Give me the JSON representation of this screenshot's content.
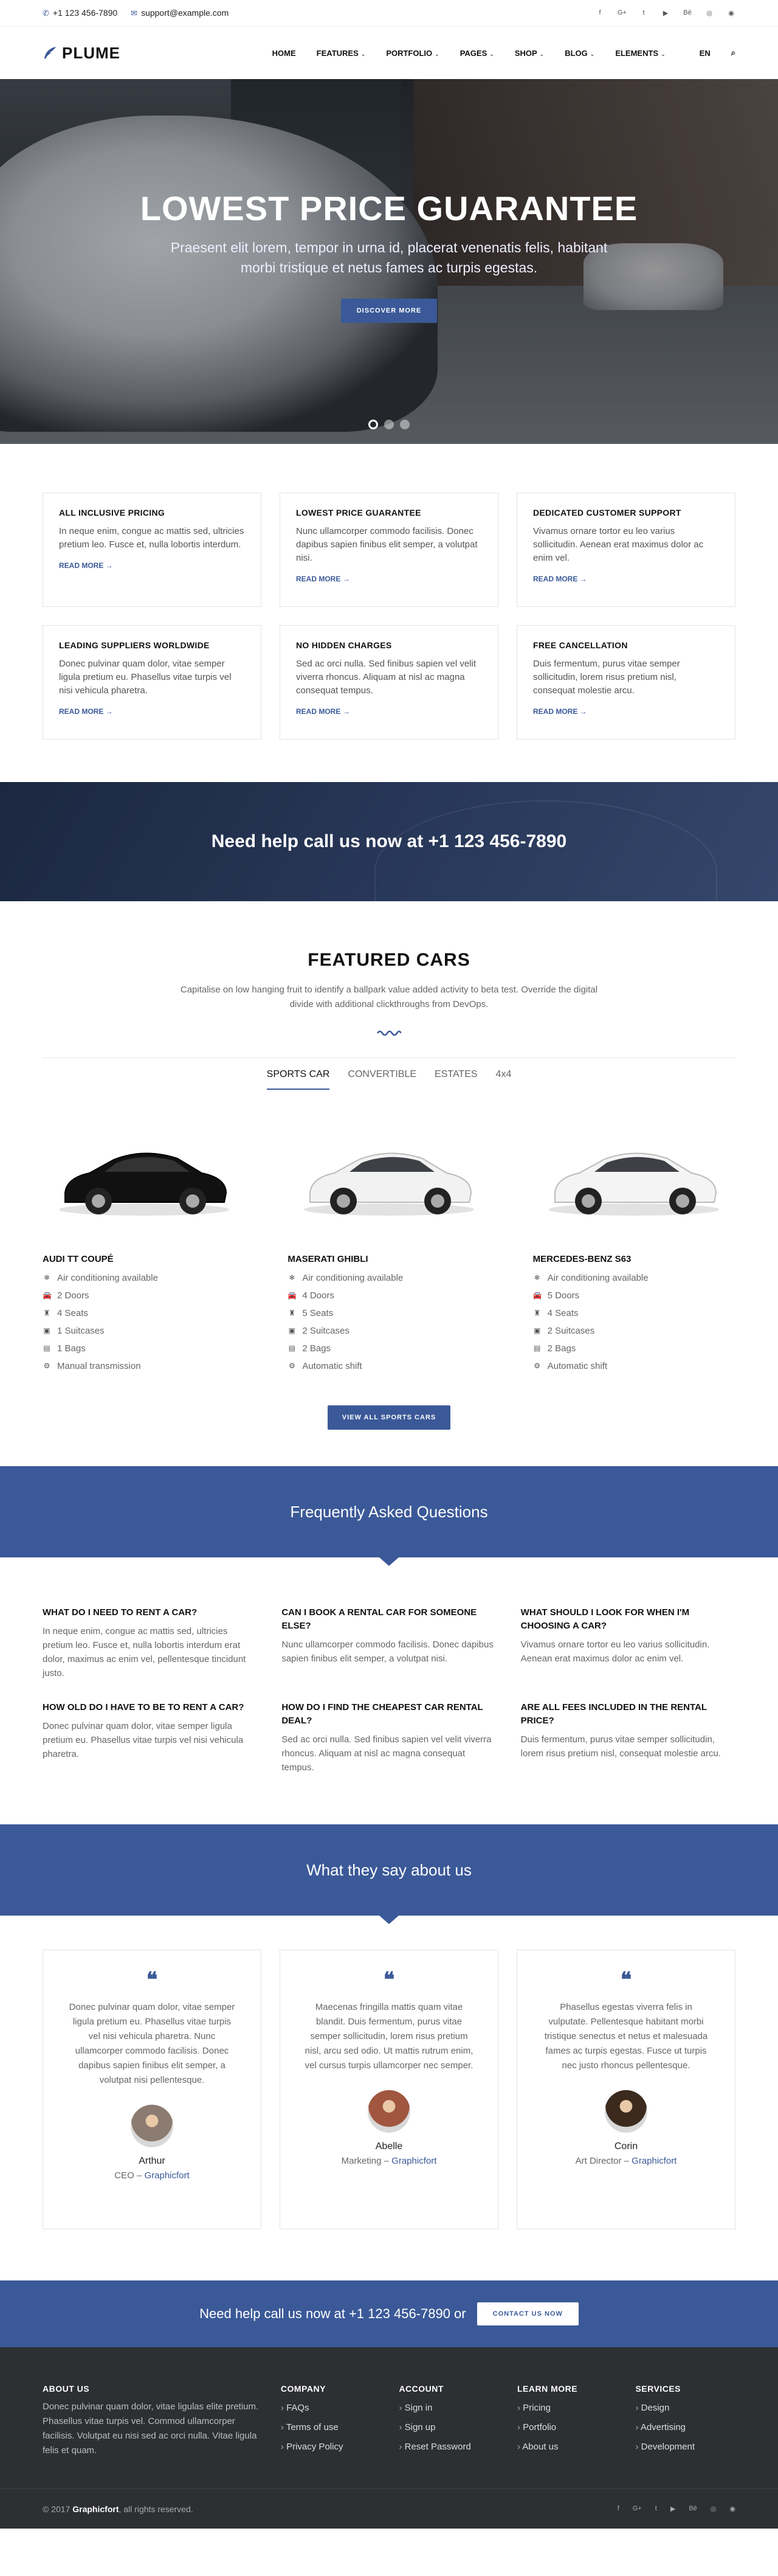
{
  "topbar": {
    "phone": "+1 123 456-7890",
    "email": "support@example.com",
    "social": [
      "f",
      "G+",
      "t",
      "▶",
      "Bē",
      "◎",
      "◉"
    ]
  },
  "header": {
    "logo": "PLUME",
    "nav": [
      {
        "label": "HOME",
        "caret": false
      },
      {
        "label": "FEATURES",
        "caret": true
      },
      {
        "label": "PORTFOLIO",
        "caret": true
      },
      {
        "label": "PAGES",
        "caret": true
      },
      {
        "label": "SHOP",
        "caret": true
      },
      {
        "label": "BLOG",
        "caret": true
      },
      {
        "label": "ELEMENTS",
        "caret": true
      }
    ],
    "lang": "EN"
  },
  "hero": {
    "title": "LOWEST PRICE GUARANTEE",
    "text": "Praesent elit lorem, tempor in urna id, placerat venenatis felis, habitant morbi tristique et netus fames ac turpis egestas.",
    "button": "DISCOVER MORE"
  },
  "features": [
    {
      "title": "ALL INCLUSIVE PRICING",
      "text": "In neque enim, congue ac mattis sed, ultricies pretium leo. Fusce et, nulla lobortis interdum.",
      "more": "READ MORE →"
    },
    {
      "title": "LOWEST PRICE GUARANTEE",
      "text": "Nunc ullamcorper commodo facilisis. Donec dapibus sapien finibus elit semper, a volutpat nisi.",
      "more": "READ MORE →"
    },
    {
      "title": "DEDICATED CUSTOMER SUPPORT",
      "text": "Vivamus ornare tortor eu leo varius sollicitudin. Aenean erat maximus dolor ac enim vel.",
      "more": "READ MORE →"
    },
    {
      "title": "LEADING SUPPLIERS WORLDWIDE",
      "text": "Donec pulvinar quam dolor, vitae semper ligula pretium eu. Phasellus vitae turpis vel nisi vehicula pharetra.",
      "more": "READ MORE →"
    },
    {
      "title": "NO HIDDEN CHARGES",
      "text": "Sed ac orci nulla. Sed finibus sapien vel velit viverra rhoncus. Aliquam at nisl ac magna consequat tempus.",
      "more": "READ MORE →"
    },
    {
      "title": "FREE CANCELLATION",
      "text": "Duis fermentum, purus vitae semper sollicitudin, lorem risus pretium nisl, consequat molestie arcu.",
      "more": "READ MORE →"
    }
  ],
  "help_band": "Need help call us now at +1 123 456-7890",
  "featured": {
    "title": "FEATURED CARS",
    "subtitle": "Capitalise on low hanging fruit to identify a ballpark value added activity to beta test. Override the digital divide with additional clickthroughs from DevOps.",
    "tabs": [
      "SPORTS CAR",
      "CONVERTIBLE",
      "ESTATES",
      "4x4"
    ],
    "cars": [
      {
        "name": "AUDI TT COUPÉ",
        "color": "#111111",
        "specs": [
          "Air conditioning available",
          "2 Doors",
          "4 Seats",
          "1 Suitcases",
          "1 Bags",
          "Manual transmission"
        ]
      },
      {
        "name": "MASERATI GHIBLI",
        "color": "#f2f2f2",
        "specs": [
          "Air conditioning available",
          "4 Doors",
          "5 Seats",
          "2 Suitcases",
          "2 Bags",
          "Automatic shift"
        ]
      },
      {
        "name": "MERCEDES-BENZ S63",
        "color": "#f4f4f4",
        "specs": [
          "Air conditioning available",
          "5 Doors",
          "4 Seats",
          "2 Suitcases",
          "2 Bags",
          "Automatic shift"
        ]
      }
    ],
    "spec_icons": [
      "❄",
      "🚘",
      "♜",
      "▣",
      "▤",
      "⚙"
    ],
    "button": "VIEW ALL SPORTS CARS"
  },
  "faq": {
    "title": "Frequently Asked Questions",
    "items": [
      {
        "q": "WHAT DO I NEED TO RENT A CAR?",
        "a": "In neque enim, congue ac mattis sed, ultricies pretium leo. Fusce et, nulla lobortis interdum erat dolor, maximus ac enim vel, pellentesque tincidunt justo."
      },
      {
        "q": "CAN I BOOK A RENTAL CAR FOR SOMEONE ELSE?",
        "a": "Nunc ullamcorper commodo facilisis. Donec dapibus sapien finibus elit semper, a volutpat nisi."
      },
      {
        "q": "WHAT SHOULD I LOOK FOR WHEN I'M CHOOSING A CAR?",
        "a": "Vivamus ornare tortor eu leo varius sollicitudin. Aenean erat maximus dolor ac enim vel."
      },
      {
        "q": "HOW OLD DO I HAVE TO BE TO RENT A CAR?",
        "a": "Donec pulvinar quam dolor, vitae semper ligula pretium eu. Phasellus vitae turpis vel nisi vehicula pharetra."
      },
      {
        "q": "HOW DO I FIND THE CHEAPEST CAR RENTAL DEAL?",
        "a": "Sed ac orci nulla. Sed finibus sapien vel velit viverra rhoncus. Aliquam at nisl ac magna consequat tempus."
      },
      {
        "q": "ARE ALL FEES INCLUDED IN THE RENTAL PRICE?",
        "a": "Duis fermentum, purus vitae semper sollicitudin, lorem risus pretium nisl, consequat molestie arcu."
      }
    ]
  },
  "testimonials": {
    "title": "What they say about us",
    "items": [
      {
        "text": "Donec pulvinar quam dolor, vitae semper ligula pretium eu. Phasellus vitae turpis vel nisi vehicula pharetra. Nunc ullamcorper commodo facilisis. Donec dapibus sapien finibus elit semper, a volutpat nisi pellentesque.",
        "name": "Arthur",
        "role": "CEO – ",
        "company": "Graphicfort",
        "avatar_color": "#8c7b70"
      },
      {
        "text": "Maecenas fringilla mattis quam vitae blandit. Duis fermentum, purus vitae semper sollicitudin, lorem risus pretium nisl, arcu sed odio. Ut mattis rutrum enim, vel cursus turpis ullamcorper nec semper.",
        "name": "Abelle",
        "role": "Marketing – ",
        "company": "Graphicfort",
        "avatar_color": "#a0563f"
      },
      {
        "text": "Phasellus egestas viverra felis in vulputate. Pellentesque habitant morbi tristique senectus et netus et malesuada fames ac turpis egestas. Fusce ut turpis nec justo rhoncus pellentesque.",
        "name": "Corin",
        "role": "Art Director – ",
        "company": "Graphicfort",
        "avatar_color": "#3b2a1d"
      }
    ]
  },
  "cta": {
    "text": "Need help call us now at +1 123 456-7890 or",
    "button": "CONTACT US NOW"
  },
  "footer": {
    "about_title": "ABOUT US",
    "about_text": "Donec pulvinar quam dolor, vitae ligulas elite pretium. Phasellus vitae turpis vel. Commod ullamcorper facilisis. Volutpat eu nisi sed ac orci nulla. Vitae ligula felis et quam.",
    "columns": [
      {
        "title": "COMPANY",
        "links": [
          "FAQs",
          "Terms of use",
          "Privacy Policy"
        ]
      },
      {
        "title": "ACCOUNT",
        "links": [
          "Sign in",
          "Sign up",
          "Reset Password"
        ]
      },
      {
        "title": "LEARN MORE",
        "links": [
          "Pricing",
          "Portfolio",
          "About us"
        ]
      },
      {
        "title": "SERVICES",
        "links": [
          "Design",
          "Advertising",
          "Development"
        ]
      }
    ],
    "copyright_pre": "© 2017 ",
    "copyright_brand": "Graphicfort",
    "copyright_post": ", all rights reserved."
  },
  "colors": {
    "accent": "#3b5998",
    "dark": "#2d2f33"
  }
}
